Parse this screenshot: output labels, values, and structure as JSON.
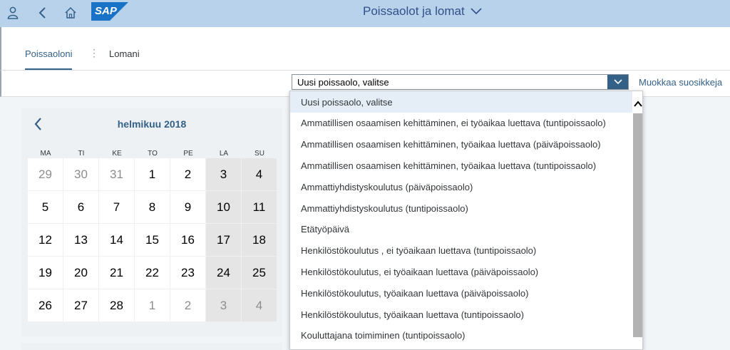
{
  "shell": {
    "title": "Poissaolot ja lomat",
    "logo_text": "SAP"
  },
  "tabs": [
    {
      "label": "Poissaoloni",
      "active": true
    },
    {
      "label": "Lomani",
      "active": false
    }
  ],
  "toolbar": {
    "select_value": "Uusi poissaolo, valitse",
    "favorites_link": "Muokkaa suosikkeja"
  },
  "calendar": {
    "month_title": "helmikuu 2018",
    "weekdays": [
      "MA",
      "TI",
      "KE",
      "TO",
      "PE",
      "LA",
      "SU"
    ],
    "weeks": [
      [
        "29",
        "30",
        "31",
        "1",
        "2",
        "3",
        "4"
      ],
      [
        "5",
        "6",
        "7",
        "8",
        "9",
        "10",
        "11"
      ],
      [
        "12",
        "13",
        "14",
        "15",
        "16",
        "17",
        "18"
      ],
      [
        "19",
        "20",
        "21",
        "22",
        "23",
        "24",
        "25"
      ],
      [
        "26",
        "27",
        "28",
        "1",
        "2",
        "3",
        "4"
      ]
    ]
  },
  "dropdown": {
    "options": [
      "Uusi poissaolo, valitse",
      "Ammatillisen osaamisen kehittäminen, ei työaikaa luettava (tuntipoissaolo)",
      "Ammatillisen osaamisen kehittäminen, työaikaa luettava (päiväpoissaolo)",
      "Ammatillisen osaamisen kehittäminen, työaikaa luettava (tuntipoissaolo)",
      "Ammattiyhdistyskoulutus (päiväpoissaolo)",
      "Ammattiyhdistyskoulutus (tuntipoissaolo)",
      "Etätyöpäivä",
      "Henkilöstökoulutus , ei työaikaan luettava (tuntipoissaolo)",
      "Henkilöstökoulutus, ei työaikaan luettava (päiväpoissaolo)",
      "Henkilöstökoulutus, työaikaan luettava (päiväpoissaolo)",
      "Henkilöstökoulutus, työaikaan luettava (tuntipoissaolo)",
      "Kouluttajana toimiminen (tuntipoissaolo)"
    ]
  },
  "colors": {
    "shell_bg": "#b8d2ec",
    "accent": "#346187",
    "weekend_bg": "#e5e5e5",
    "other_month_text": "#8d8d8d"
  }
}
